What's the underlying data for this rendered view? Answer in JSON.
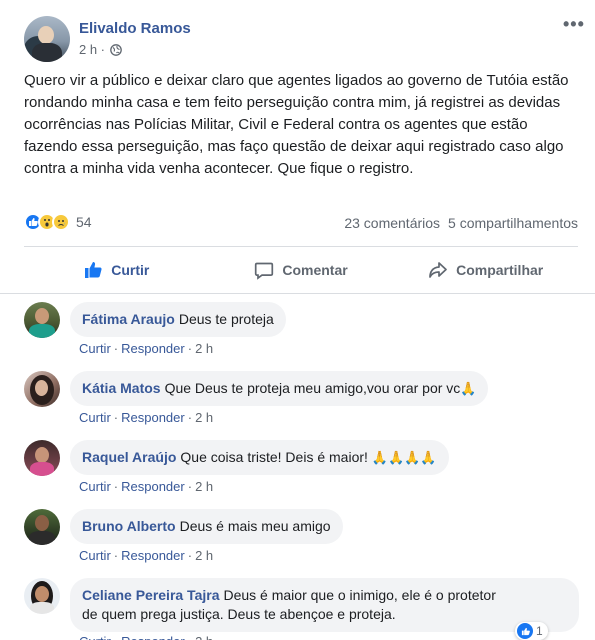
{
  "post": {
    "author": "Elivaldo Ramos",
    "time": "2 h ·",
    "text": "Quero vir a público e deixar claro que agentes ligados ao governo de Tutóia estão rondando minha casa e tem feito perseguição contra mim, já registrei as devidas ocorrências nas Polícias Militar, Civil e Federal contra os agentes que estão fazendo essa perseguição, mas faço questão de deixar aqui registrado caso algo contra a minha vida venha acontecer. Que fique o registro.",
    "more_icon": "more-icon",
    "privacy_icon": "globe-icon"
  },
  "reactions": {
    "icons": [
      "like-icon",
      "wow-icon",
      "sad-icon"
    ],
    "count": "54",
    "comments": "23 comentários",
    "shares": "5 compartilhamentos"
  },
  "actions": {
    "like": "Curtir",
    "comment": "Comentar",
    "share": "Compartilhar"
  },
  "comment_actions": {
    "like": "Curtir",
    "reply": "Responder",
    "time": "2 h"
  },
  "comments": [
    {
      "name": "Fátima Araujo",
      "text": "Deus te proteja"
    },
    {
      "name": "Kátia Matos",
      "text": "Que Deus te proteja meu amigo,vou orar por vc"
    },
    {
      "name": "Raquel Araújo",
      "text": "Que coisa triste! Deis é maior!"
    },
    {
      "name": "Bruno Alberto",
      "text": "Deus é mais meu amigo"
    },
    {
      "name": "Celiane Pereira Tajra",
      "text": "Deus é maior que o inimigo, ele é o protetor",
      "text2": "de quem prega justiça. Deus te abençoe e proteja."
    }
  ],
  "last_comment_reactions": "1",
  "colors": {
    "link_blue": "#385898",
    "facebook_blue": "#1877f2",
    "bubble_grey": "#f2f3f5",
    "meta_grey": "#606770"
  }
}
